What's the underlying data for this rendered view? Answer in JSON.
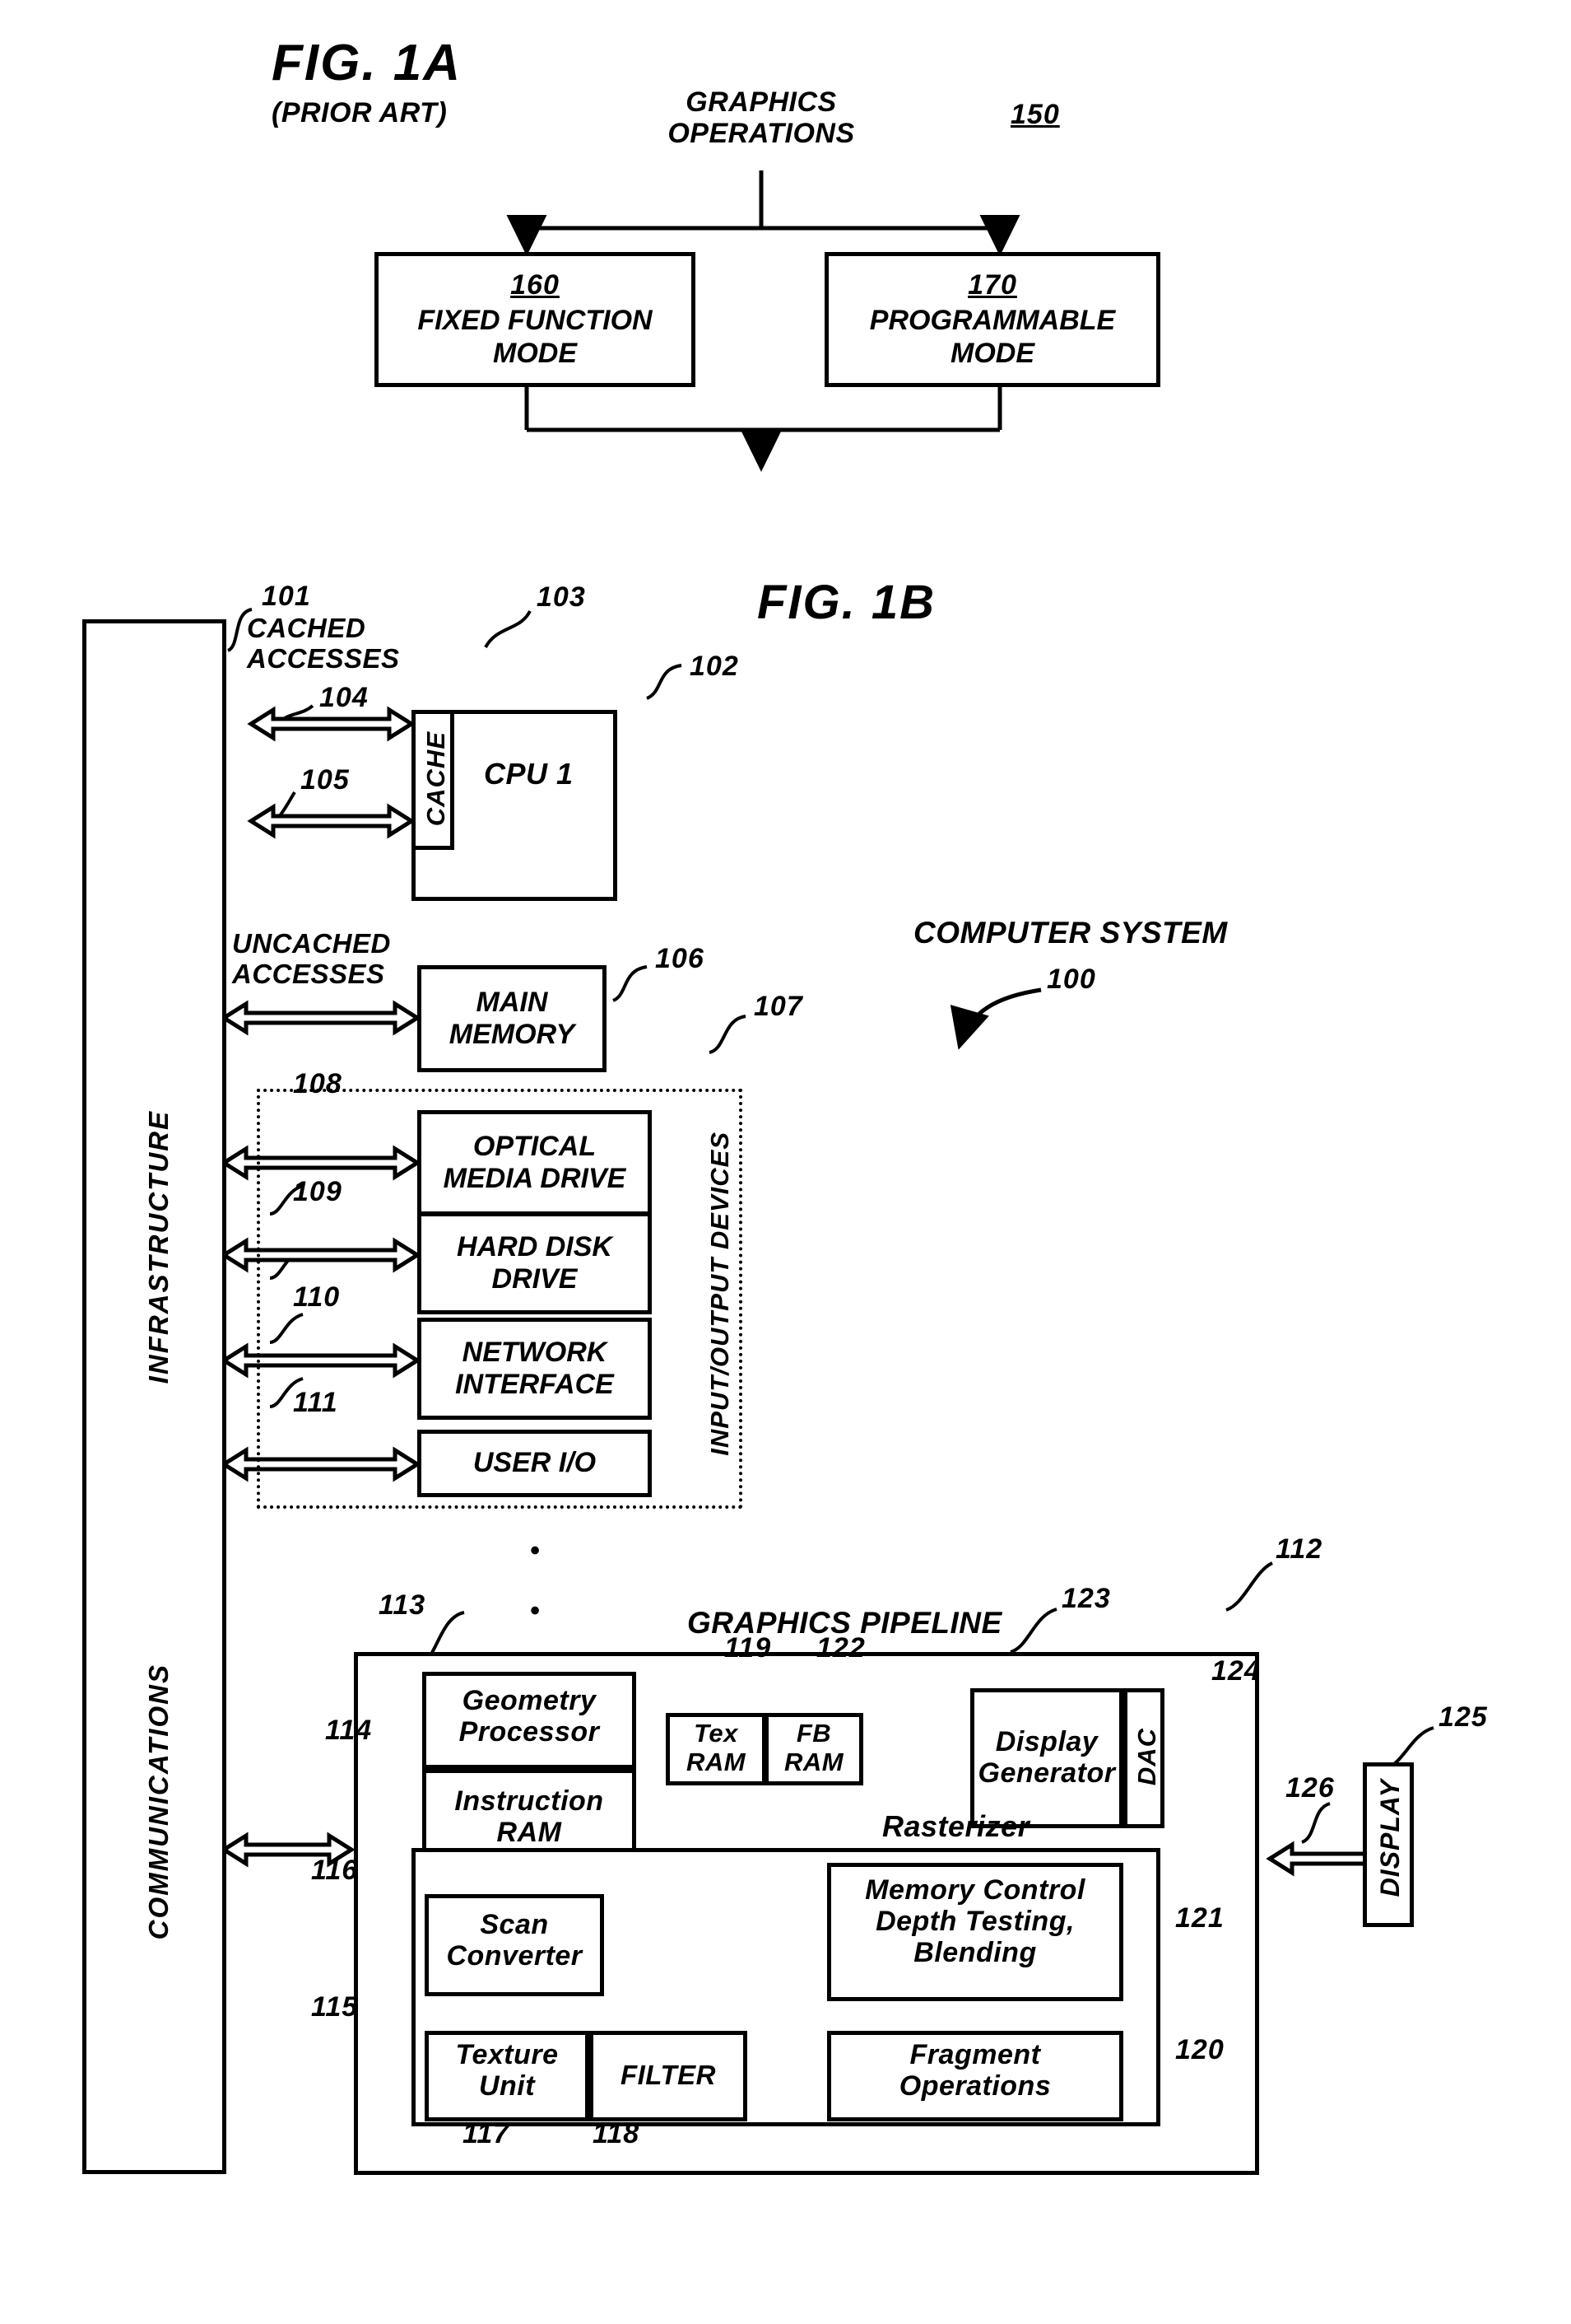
{
  "fig1a": {
    "title": "FIG. 1A",
    "subtitle": "(PRIOR ART)",
    "top_label": "GRAPHICS\nOPERATIONS",
    "ref_150": "150",
    "boxes": [
      {
        "ref": "160",
        "label": "FIXED FUNCTION\nMODE"
      },
      {
        "ref": "170",
        "label": "PROGRAMMABLE\nMODE"
      }
    ]
  },
  "fig1b": {
    "title": "FIG. 1B",
    "system_label": "COMPUTER SYSTEM",
    "system_ref": "100",
    "bus": {
      "infrastructure_label": "INFRASTRUCTURE",
      "communications_label": "COMMUNICATIONS"
    },
    "labels": {
      "cached_accesses": "CACHED\nACCESSES",
      "uncached_accesses": "UNCACHED\nACCESSES",
      "io_devices": "INPUT/OUTPUT DEVICES",
      "graphics_pipeline": "GRAPHICS PIPELINE",
      "rasterizer": "Rasterizer"
    },
    "blocks": {
      "cache": "CACHE",
      "cpu": "CPU 1",
      "main_memory": "MAIN\nMEMORY",
      "optical_media_drive": "OPTICAL\nMEDIA DRIVE",
      "hard_disk_drive": "HARD DISK\nDRIVE",
      "network_interface": "NETWORK\nINTERFACE",
      "user_io": "USER I/O",
      "geometry_processor": "Geometry\nProcessor",
      "instruction_ram": "Instruction\nRAM",
      "tex_ram": "Tex\nRAM",
      "fb_ram": "FB\nRAM",
      "display_generator": "Display\nGenerator",
      "dac": "DAC",
      "display": "DISPLAY",
      "scan_converter": "Scan\nConverter",
      "texture_unit": "Texture\nUnit",
      "filter": "FILTER",
      "fragment_operations": "Fragment\nOperations",
      "memory_control": "Memory Control\nDepth Testing,\nBlending"
    },
    "refs": {
      "r101": "101",
      "r102": "102",
      "r103": "103",
      "r104": "104",
      "r105": "105",
      "r106": "106",
      "r107": "107",
      "r108": "108",
      "r109": "109",
      "r110": "110",
      "r111": "111",
      "r112": "112",
      "r113": "113",
      "r114": "114",
      "r115": "115",
      "r116": "116",
      "r117": "117",
      "r118": "118",
      "r119": "119",
      "r120": "120",
      "r121": "121",
      "r122": "122",
      "r123": "123",
      "r124": "124",
      "r125": "125",
      "r126": "126"
    },
    "ellipsis": "•"
  },
  "colors": {
    "ink": "#000000",
    "paper": "#ffffff"
  }
}
